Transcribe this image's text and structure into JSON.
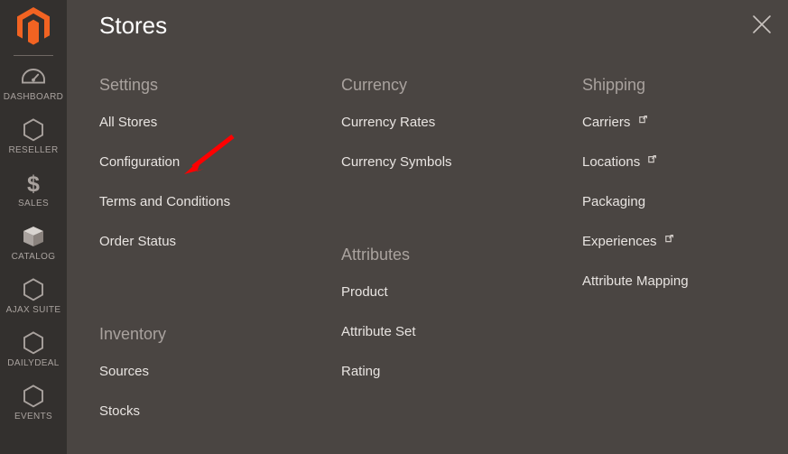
{
  "sidebar": {
    "logo": {
      "icon": "magento-logo-icon",
      "color": "#f26322"
    },
    "items": [
      {
        "label": "Dashboard",
        "icon": "gauge-icon"
      },
      {
        "label": "Reseller",
        "icon": "hexagon-icon"
      },
      {
        "label": "Sales",
        "icon": "dollar-sign-icon"
      },
      {
        "label": "Catalog",
        "icon": "box-icon"
      },
      {
        "label": "Ajax Suite",
        "icon": "hexagon-icon"
      },
      {
        "label": "Dailydeal",
        "icon": "hexagon-icon"
      },
      {
        "label": "Events",
        "icon": "hexagon-icon"
      }
    ]
  },
  "panel": {
    "title": "Stores",
    "close_label": "close-icon",
    "columns": [
      {
        "groups": [
          {
            "title": "Settings",
            "links": [
              {
                "label": "All Stores",
                "external": false
              },
              {
                "label": "Configuration",
                "external": false
              },
              {
                "label": "Terms and Conditions",
                "external": false
              },
              {
                "label": "Order Status",
                "external": false
              }
            ]
          },
          {
            "title": "Inventory",
            "links": [
              {
                "label": "Sources",
                "external": false
              },
              {
                "label": "Stocks",
                "external": false
              }
            ]
          }
        ]
      },
      {
        "groups": [
          {
            "title": "Currency",
            "links": [
              {
                "label": "Currency Rates",
                "external": false
              },
              {
                "label": "Currency Symbols",
                "external": false
              }
            ]
          },
          {
            "title": "Attributes",
            "links": [
              {
                "label": "Product",
                "external": false
              },
              {
                "label": "Attribute Set",
                "external": false
              },
              {
                "label": "Rating",
                "external": false
              }
            ]
          }
        ]
      },
      {
        "groups": [
          {
            "title": "Shipping",
            "links": [
              {
                "label": "Carriers",
                "external": true
              },
              {
                "label": "Locations",
                "external": true
              },
              {
                "label": "Packaging",
                "external": false
              },
              {
                "label": "Experiences",
                "external": true
              },
              {
                "label": "Attribute Mapping",
                "external": false
              }
            ]
          }
        ]
      }
    ]
  },
  "annotation": {
    "arrow_color": "#ff0000",
    "points_to": "Configuration"
  },
  "colors": {
    "sidebar_bg": "#33302e",
    "panel_bg": "#4a4542",
    "heading_text": "#a9a29e",
    "link_text": "#e8e4e1",
    "title_text": "#ffffff",
    "brand_orange": "#f26322"
  }
}
